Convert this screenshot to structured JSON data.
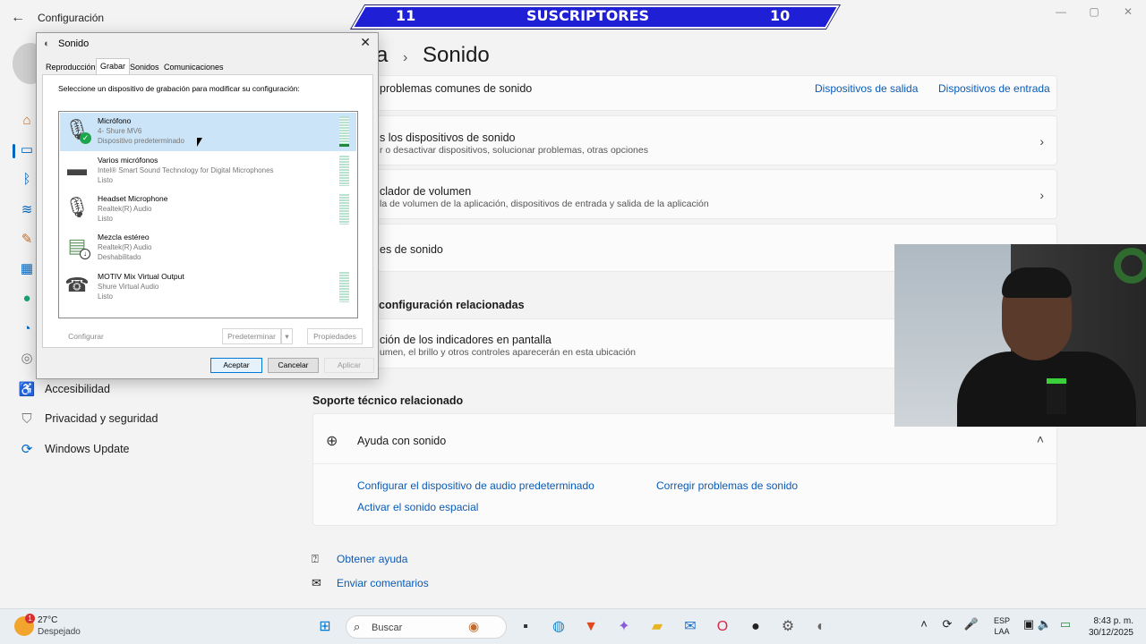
{
  "settings": {
    "app_title": "Configuración",
    "page_title_prefix": "a",
    "page_title": "Sonido",
    "sidebar": {
      "items": [
        {
          "label": "Accesibilidad",
          "icon": "accessibility-icon"
        },
        {
          "label": "Privacidad y seguridad",
          "icon": "shield-icon"
        },
        {
          "label": "Windows Update",
          "icon": "update-icon"
        }
      ]
    },
    "rows": {
      "troubleshoot": "problemas comunes de sonido",
      "output_devices_link": "Dispositivos de salida",
      "input_devices_link": "Dispositivos de entrada",
      "all_devices_title": "s los dispositivos de sonido",
      "all_devices_sub": "r o desactivar dispositivos, solucionar problemas, otras opciones",
      "mixer_title": "clador de volumen",
      "mixer_sub": "la de volumen de la aplicación, dispositivos de entrada y salida de la aplicación",
      "more_title": "es de sonido",
      "related_header": "configuración relacionadas",
      "indicators_title": "ción de los indicadores en pantalla",
      "indicators_sub": "umen, el brillo y otros controles aparecerán en esta ubicación",
      "support_header": "Soporte técnico relacionado",
      "help_title": "Ayuda con sonido",
      "help_link1": "Configurar el dispositivo de audio predeterminado",
      "help_link2": "Corregir problemas de sonido",
      "help_link3": "Activar el sonido espacial",
      "get_help": "Obtener ayuda",
      "feedback": "Enviar comentarios"
    }
  },
  "banner": {
    "left": "11",
    "center": "SUSCRIPTORES",
    "right": "10"
  },
  "dialog": {
    "title": "Sonido",
    "tabs": [
      "Reproducción",
      "Grabar",
      "Sonidos",
      "Comunicaciones"
    ],
    "active_tab": "Grabar",
    "instruction": "Seleccione un dispositivo de grabación para modificar su configuración:",
    "devices": [
      {
        "name": "Micrófono",
        "sub": "4- Shure MV6",
        "status": "Dispositivo predeterminado",
        "selected": true,
        "level": 0.08
      },
      {
        "name": "Varios micrófonos",
        "sub": "Intel® Smart Sound Technology for Digital Microphones",
        "status": "Listo"
      },
      {
        "name": "Headset Microphone",
        "sub": "Realtek(R) Audio",
        "status": "Listo"
      },
      {
        "name": "Mezcla estéreo",
        "sub": "Realtek(R) Audio",
        "status": "Deshabilitado"
      },
      {
        "name": "MOTIV Mix Virtual Output",
        "sub": "Shure Virtual Audio",
        "status": "Listo"
      }
    ],
    "buttons": {
      "configure": "Configurar",
      "set_default": "Predeterminar",
      "properties": "Propiedades",
      "ok": "Aceptar",
      "cancel": "Cancelar",
      "apply": "Aplicar"
    }
  },
  "taskbar": {
    "weather_temp": "27°C",
    "weather_desc": "Despejado",
    "weather_badge": "1",
    "search_placeholder": "Buscar",
    "lang_top": "ESP",
    "lang_bottom": "LAA",
    "time": "8:43 p. m.",
    "date": "30/12/2025"
  },
  "colors": {
    "accent": "#0067c0",
    "link": "#0a5bb5",
    "banner": "#1f20d6"
  }
}
